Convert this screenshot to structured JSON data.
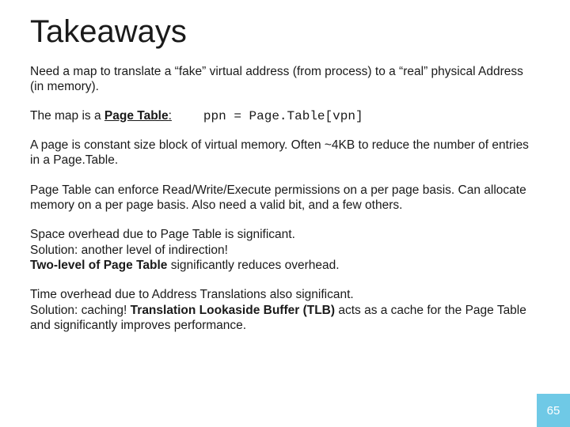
{
  "title": "Takeaways",
  "p_need": "Need a map to translate a “fake” virtual address (from process) to a “real” physical Address (in memory).",
  "map_label_pre": "The map is a ",
  "map_label_bold": "Page Table",
  "map_label_post": ":",
  "map_code": "ppn = Page.Table[vpn]",
  "p_page": "A page is constant size block of virtual memory.  Often ~4KB to reduce the number of entries in a Page.Table.",
  "p_perm": "Page Table can enforce Read/Write/Execute permissions on a per page basis.  Can allocate memory on a per page basis.  Also need a valid bit, and a few others.",
  "space_line1": "Space overhead due to Page Table is significant.",
  "space_line2": "Solution: another level of indirection!",
  "space_bold": "Two-level of Page Table",
  "space_after": " significantly reduces overhead.",
  "time_line1": "Time overhead due to Address Translations also significant.",
  "time_pre": "Solution: caching!  ",
  "time_bold": "Translation Lookaside Buffer (TLB)",
  "time_after": " acts as a cache for the Page Table and significantly improves performance.",
  "page_number": "65"
}
